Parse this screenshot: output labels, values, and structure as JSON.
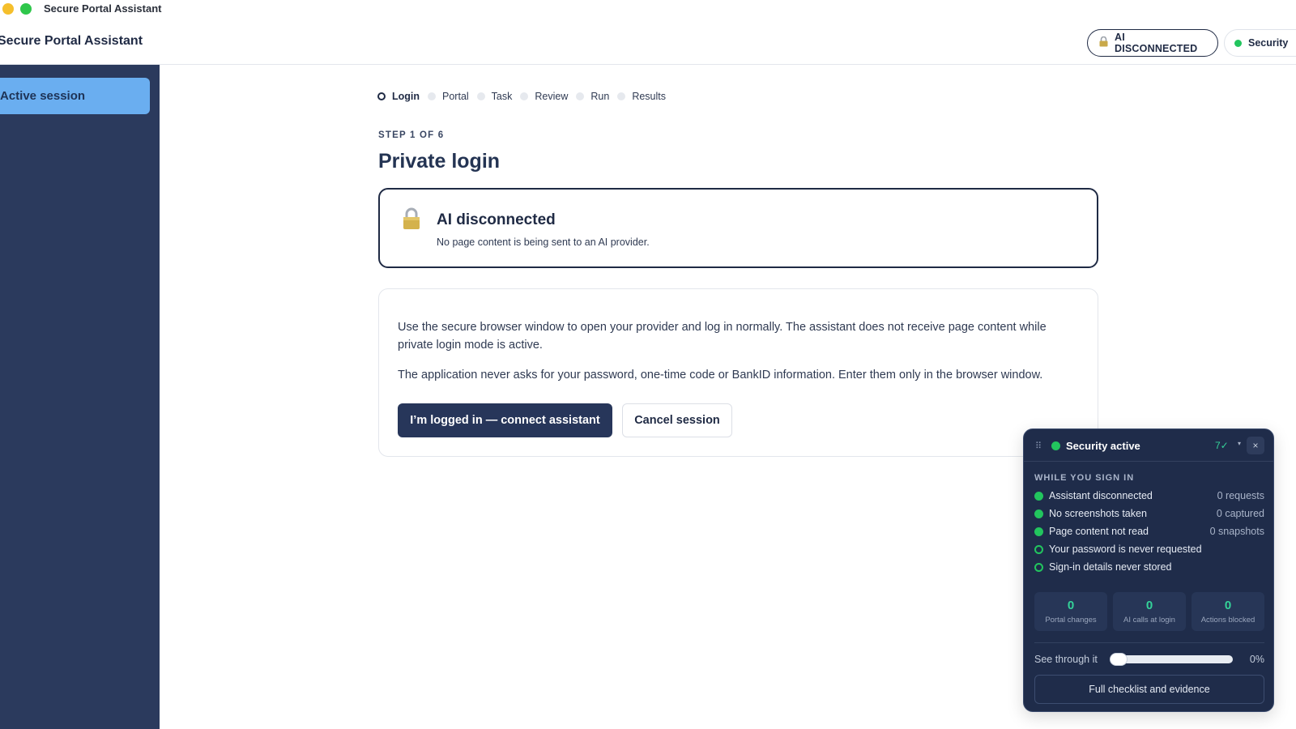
{
  "window": {
    "title": "Secure Portal Assistant"
  },
  "header": {
    "app_title": "Secure Portal Assistant",
    "ai_status_label": "AI DISCONNECTED",
    "security_label": "Security"
  },
  "sidebar": {
    "items": [
      {
        "label": "Active session",
        "active": true
      }
    ]
  },
  "stepper": {
    "steps": [
      {
        "label": "Login",
        "active": true
      },
      {
        "label": "Portal",
        "active": false
      },
      {
        "label": "Task",
        "active": false
      },
      {
        "label": "Review",
        "active": false
      },
      {
        "label": "Run",
        "active": false
      },
      {
        "label": "Results",
        "active": false
      }
    ]
  },
  "main": {
    "step_counter": "STEP 1 OF 6",
    "title": "Private login",
    "alert": {
      "icon": "lock-icon",
      "title": "AI disconnected",
      "subtitle": "No page content is being sent to an AI provider."
    },
    "paragraph_1": "Use the secure browser window to open your provider and log in normally. The assistant does not receive page content while private login mode is active.",
    "paragraph_2": "The application never asks for your password, one-time code or BankID information. Enter them only in the browser window.",
    "primary_button": "I’m logged in — connect assistant",
    "secondary_button": "Cancel session"
  },
  "security_panel": {
    "title": "Security active",
    "check_count": "7✓",
    "close_label": "×",
    "section_label": "WHILE YOU SIGN IN",
    "items": [
      {
        "label": "Assistant disconnected",
        "value": "0 requests",
        "indicator": "filled"
      },
      {
        "label": "No screenshots taken",
        "value": "0 captured",
        "indicator": "filled"
      },
      {
        "label": "Page content not read",
        "value": "0 snapshots",
        "indicator": "filled"
      },
      {
        "label": "Your password is never requested",
        "value": "",
        "indicator": "ring"
      },
      {
        "label": "Sign-in details never stored",
        "value": "",
        "indicator": "ring"
      }
    ],
    "stats": [
      {
        "value": "0",
        "caption": "Portal changes"
      },
      {
        "value": "0",
        "caption": "AI calls at login"
      },
      {
        "value": "0",
        "caption": "Actions blocked"
      }
    ],
    "see_through_label": "See through it",
    "see_through_value": "0%",
    "see_through_fraction": 0,
    "evidence_button": "Full checklist and evidence"
  },
  "colors": {
    "sidebar_bg": "#2b3a5d",
    "sidebar_active": "#6aaef0",
    "primary_button": "#27365a",
    "accent_green": "#22c55e",
    "panel_bg": "#1f2c4a"
  }
}
